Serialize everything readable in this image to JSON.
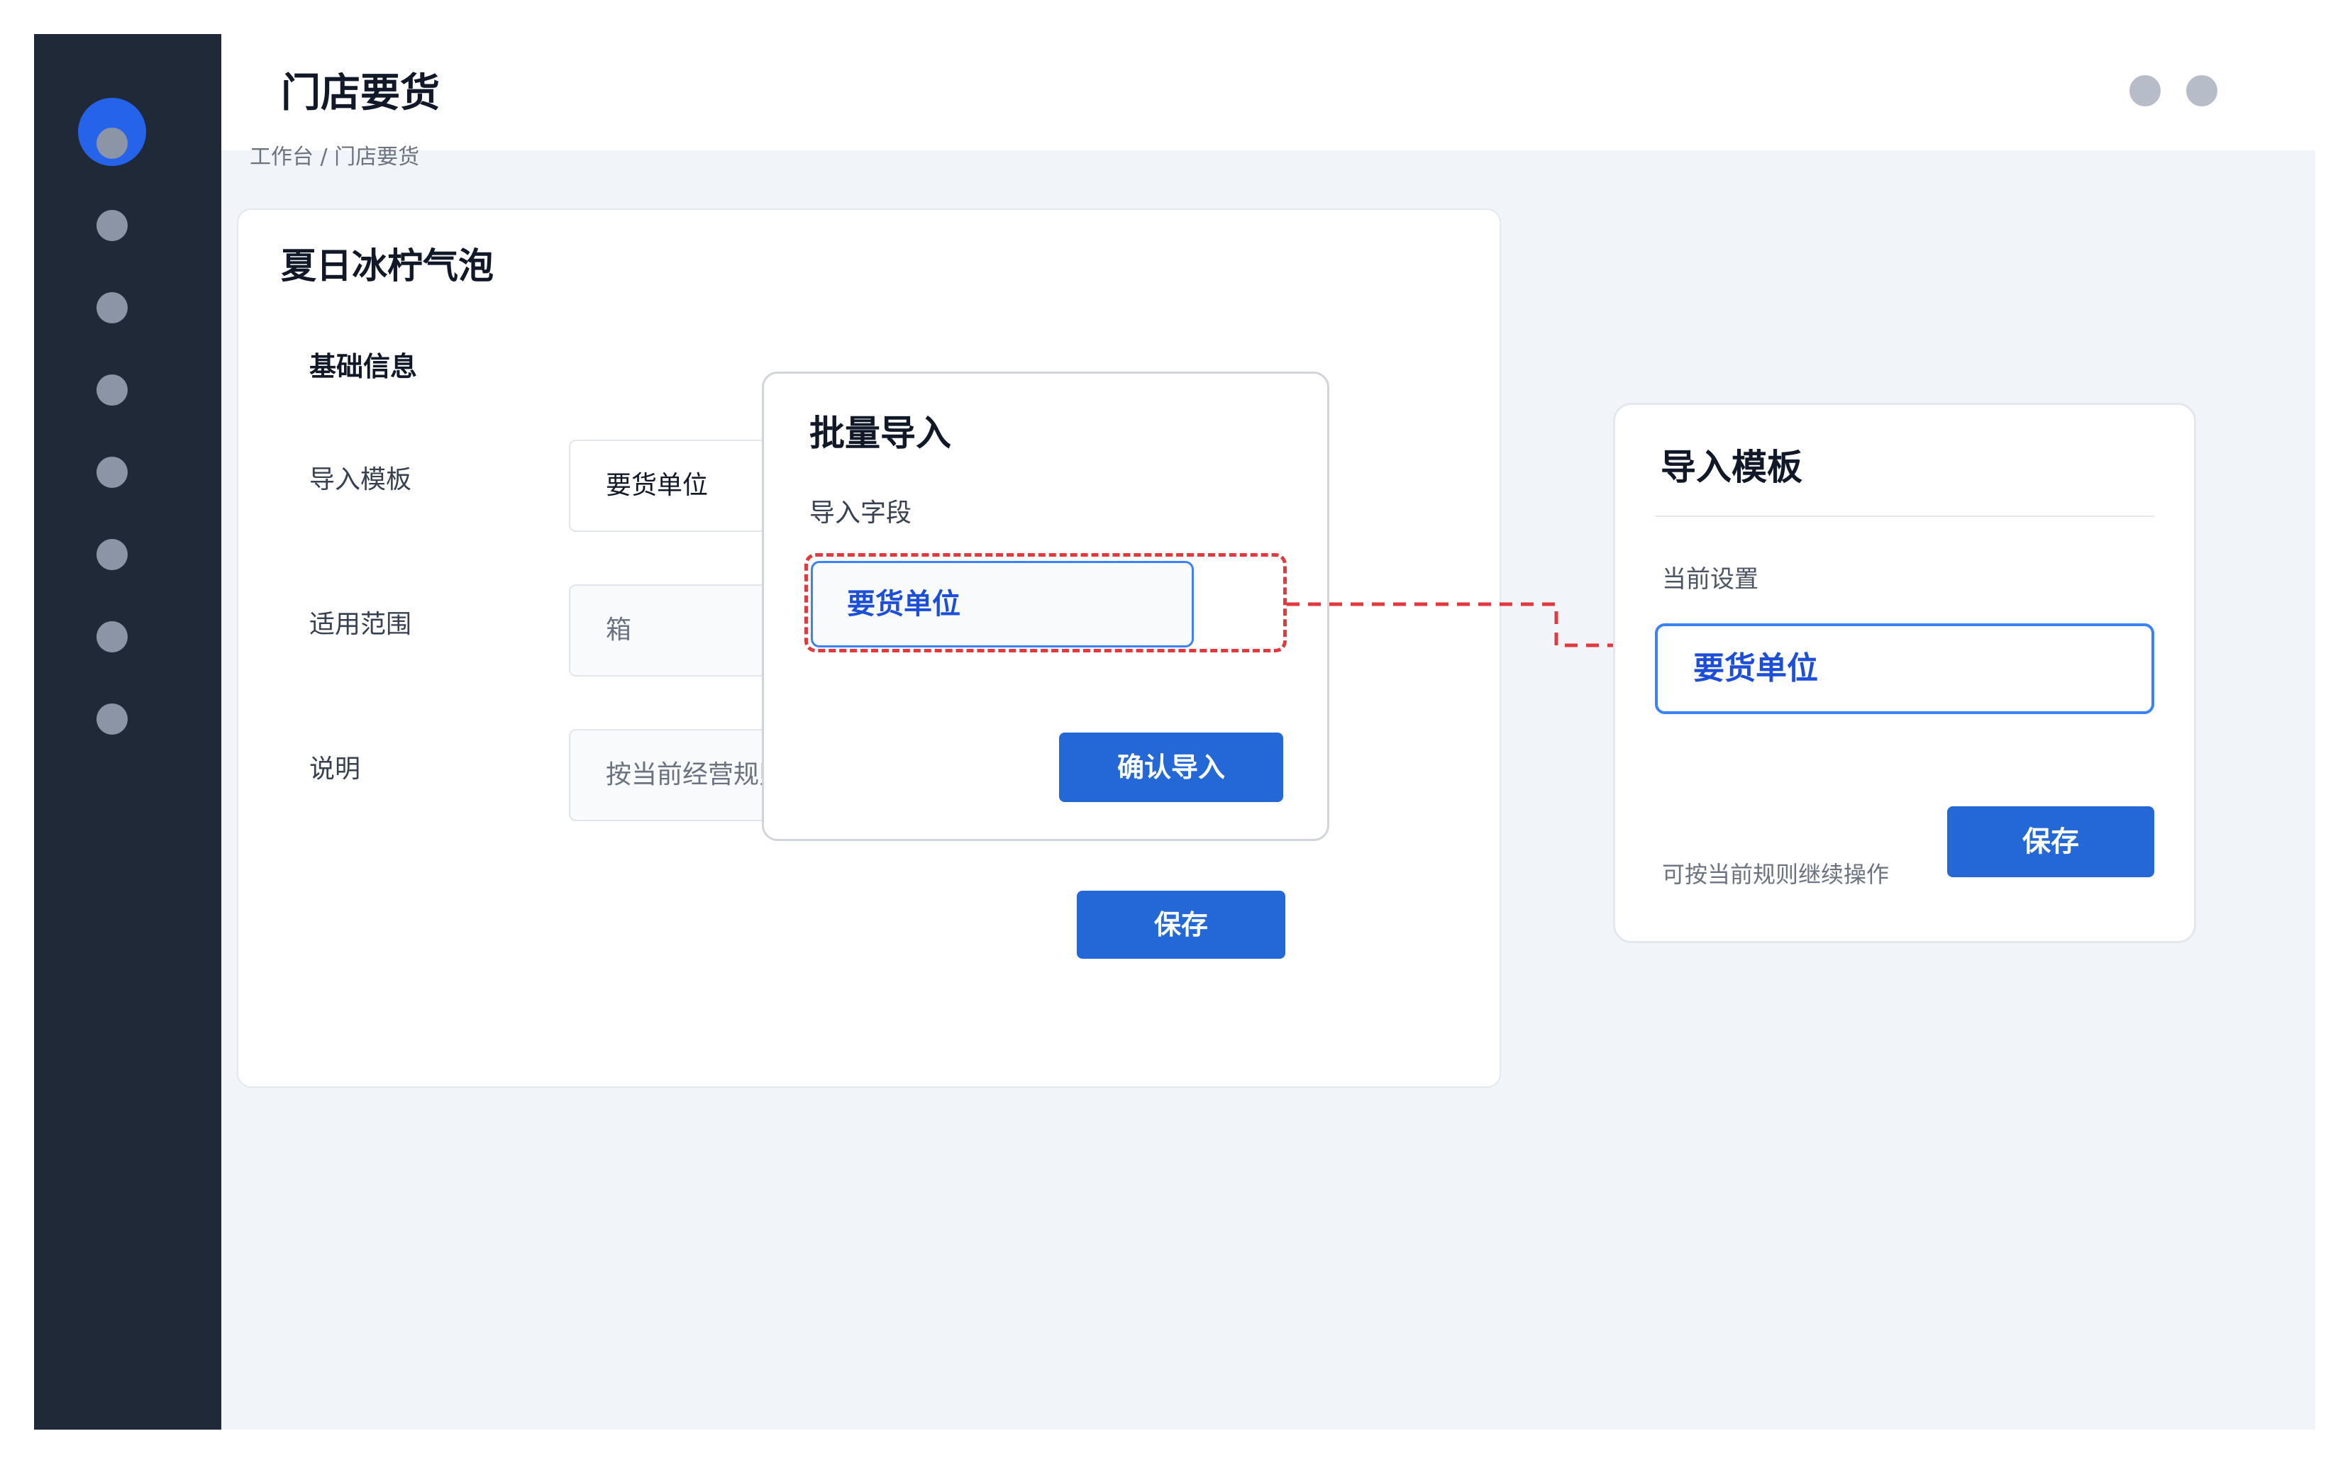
{
  "header": {
    "title": "门店要货"
  },
  "breadcrumb": "工作台 / 门店要货",
  "main_card": {
    "title": "夏日冰柠气泡",
    "section_title": "基础信息",
    "fields": [
      {
        "label": "导入模板",
        "value": "要货单位"
      },
      {
        "label": "适用范围",
        "value": "箱"
      },
      {
        "label": "说明",
        "value": "按当前经营规则处理"
      }
    ],
    "save_label": "保存"
  },
  "modal": {
    "title": "批量导入",
    "field_label": "导入字段",
    "field_value": "要货单位",
    "confirm_label": "确认导入"
  },
  "side_panel": {
    "title": "导入模板",
    "current_label": "当前设置",
    "current_value": "要货单位",
    "save_label": "保存",
    "hint": "可按当前规则继续操作"
  },
  "colors": {
    "sidebar": "#1f2937",
    "accent": "#2563eb",
    "button": "#2368d6",
    "highlight": "#e0393e"
  }
}
